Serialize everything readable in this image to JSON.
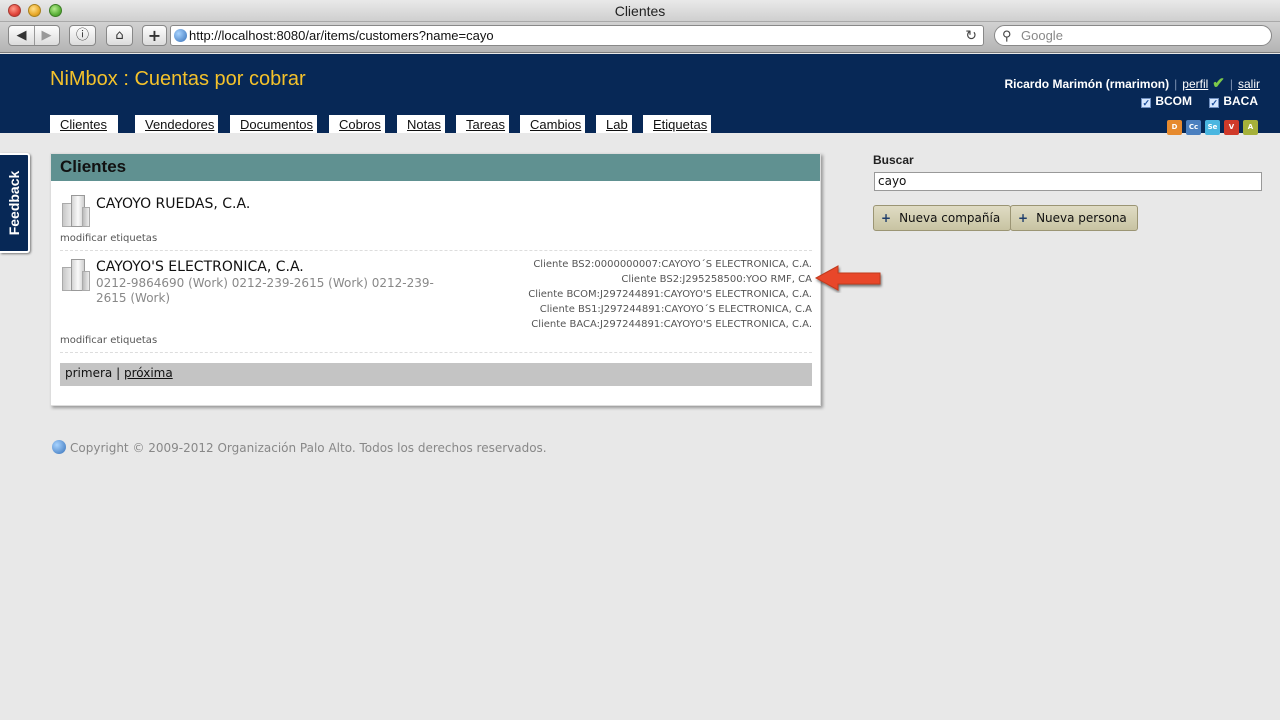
{
  "window": {
    "title": "Clientes"
  },
  "browser": {
    "url": "http://localhost:8080/ar/items/customers?name=cayo",
    "search_placeholder": "Google"
  },
  "header": {
    "brand": "NiMbox : Cuentas por cobrar",
    "user": "Ricardo Marimón (rmarimon)",
    "profile_link": "perfil",
    "logout_link": "salir",
    "companies": [
      "BCOM",
      "BACA"
    ],
    "mini_icons": [
      {
        "name": "d-icon",
        "label": "D",
        "color": "#e68a2e"
      },
      {
        "name": "cc-icon",
        "label": "Cc",
        "color": "#4a7fbf"
      },
      {
        "name": "se-icon",
        "label": "Se",
        "color": "#49b6e0"
      },
      {
        "name": "v-icon",
        "label": "V",
        "color": "#d03a2a"
      },
      {
        "name": "a-icon",
        "label": "A",
        "color": "#a5b13a"
      }
    ]
  },
  "tabs": [
    "Clientes",
    "Vendedores",
    "Documentos",
    "Cobros",
    "Notas",
    "Tareas",
    "Cambios",
    "Lab",
    "Etiquetas"
  ],
  "feedback": "Feedback",
  "panel": {
    "title": "Clientes",
    "entries": [
      {
        "name": "CAYOYO RUEDAS, C.A.",
        "phones": "",
        "edit_tags": "modificar etiquetas",
        "codes": []
      },
      {
        "name": "CAYOYO'S ELECTRONICA, C.A.",
        "phones": "0212-9864690 (Work) 0212-239-2615 (Work) 0212-239-2615 (Work)",
        "edit_tags": "modificar etiquetas",
        "codes": [
          "Cliente BS2:0000000007:CAYOYO´S ELECTRONICA, C.A.",
          "Cliente BS2:J295258500:YOO RMF, CA",
          "Cliente BCOM:J297244891:CAYOYO'S ELECTRONICA, C.A.",
          "Cliente BS1:J297244891:CAYOYO´S ELECTRONICA, C.A",
          "Cliente BACA:J297244891:CAYOYO'S ELECTRONICA, C.A."
        ]
      }
    ],
    "pager": {
      "first": "primera",
      "separator": "|",
      "next": "próxima"
    }
  },
  "sidebar": {
    "search_label": "Buscar",
    "search_value": "cayo",
    "new_company": "Nueva compañía",
    "new_person": "Nueva persona"
  },
  "footer": "Copyright © 2009-2012 Organización Palo Alto. Todos los derechos reservados.",
  "colors": {
    "header_bg": "#072856",
    "brand": "#f4c22b",
    "panel_header": "#609191",
    "arrow": "#e8472a"
  }
}
